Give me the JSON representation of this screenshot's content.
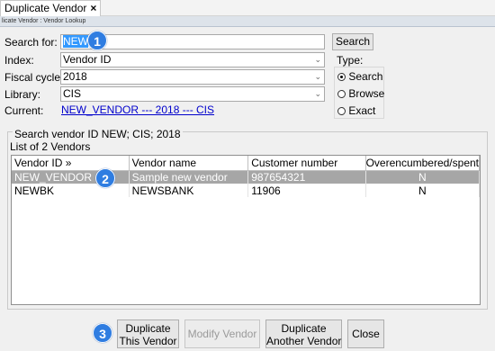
{
  "tab": {
    "title": "Duplicate Vendor",
    "close": "×"
  },
  "breadcrumb": "licate Vendor : Vendor Lookup",
  "form": {
    "search_label": "Search for:",
    "search_value": "NEW",
    "search_button": "Search",
    "index_label": "Index:",
    "index_value": "Vendor ID",
    "fiscal_label": "Fiscal cycle:",
    "fiscal_value": "2018",
    "library_label": "Library:",
    "library_value": "CIS",
    "current_label": "Current:",
    "current_link": "NEW_VENDOR --- 2018 --- CIS"
  },
  "type": {
    "label": "Type:",
    "options": [
      "Search",
      "Browse",
      "Exact"
    ],
    "selected": "Search"
  },
  "results": {
    "search_text": "Search vendor ID  NEW; CIS; 2018",
    "list_label": "List of 2 Vendors",
    "columns": [
      "Vendor ID »",
      "Vendor name",
      "Customer number",
      "Overencumbered/spent"
    ],
    "rows": [
      [
        "NEW_VENDOR",
        "Sample new vendor",
        "987654321",
        "N"
      ],
      [
        "NEWBK",
        "NEWSBANK",
        "11906",
        "N"
      ]
    ]
  },
  "buttons": {
    "duplicate_this": [
      "Duplicate",
      "This Vendor"
    ],
    "modify": "Modify Vendor",
    "duplicate_another": [
      "Duplicate",
      "Another Vendor"
    ],
    "close": "Close"
  },
  "callouts": [
    "1",
    "2",
    "3"
  ],
  "colors": {
    "badge": "#2f7de1",
    "selected_row": "#a6a6a6",
    "link": "#0000cc",
    "text_selection": "#3399ff"
  }
}
